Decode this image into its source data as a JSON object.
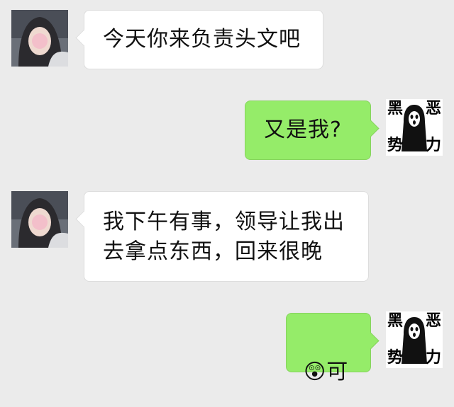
{
  "messages": [
    {
      "side": "left",
      "text": "今天你来负责头文吧"
    },
    {
      "side": "right",
      "text": "又是我?"
    },
    {
      "side": "left",
      "text": "我下午有事，领导让我出\n去拿点东西，回来很晚"
    },
    {
      "side": "right",
      "emoji": "😲",
      "text": "可"
    }
  ],
  "avatar_right": {
    "chars": [
      "黑",
      "恶",
      "势",
      "力"
    ]
  },
  "colors": {
    "background": "#ebebeb",
    "sent_bubble": "#95ec69",
    "received_bubble": "#ffffff"
  }
}
